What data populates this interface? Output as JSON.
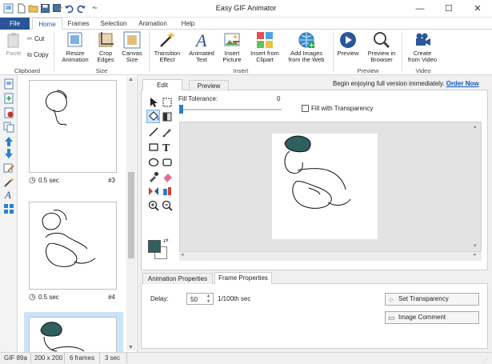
{
  "window": {
    "title": "Easy GIF Animator",
    "controls": [
      "minimize-icon",
      "maximize-icon",
      "close-icon"
    ]
  },
  "menu": {
    "file": "File",
    "tabs": [
      "Home",
      "Frames",
      "Selection",
      "Animation",
      "Help"
    ]
  },
  "ribbon": {
    "clipboard": {
      "paste": "Paste",
      "cut": "Cut",
      "copy": "Copy",
      "group": "Clipboard"
    },
    "size": {
      "resize": [
        "Resize",
        "Animation"
      ],
      "crop": [
        "Crop",
        "Edges"
      ],
      "canvas": [
        "Canvas",
        "Size"
      ],
      "group": "Size"
    },
    "insert": {
      "transition": [
        "Transition",
        "Effect"
      ],
      "text": [
        "Animated",
        "Text"
      ],
      "picture": [
        "Insert",
        "Picture"
      ],
      "clipart": [
        "Insert from",
        "Clipart"
      ],
      "web": [
        "Add Images",
        "from the Web"
      ],
      "group": "Insert"
    },
    "preview": {
      "preview": "Preview",
      "browser": [
        "Preview in",
        "Browser"
      ],
      "group": "Preview"
    },
    "video": {
      "create": [
        "Create",
        "from Video"
      ],
      "group": "Video"
    }
  },
  "frames": [
    {
      "delay": "0.5 sec",
      "number": "#3"
    },
    {
      "delay": "0.5 sec",
      "number": "#4"
    }
  ],
  "editor": {
    "tabs": [
      "Edit",
      "Preview"
    ],
    "promo": "Begin enjoying full version immediately.",
    "promo_link": "Order Now",
    "fill_tolerance_label": "Fill Tolerance:",
    "fill_tolerance_value": "0",
    "fill_transparency_label": "Fill with Transparency",
    "fill_transparency_checked": false
  },
  "colors": {
    "primary": "#2f5f5e",
    "secondary": "#ffffff",
    "accent": "#2a5699",
    "link": "#0b57c1"
  },
  "properties": {
    "tabs": [
      "Animation Properties",
      "Frame Properties"
    ],
    "delay_label": "Delay:",
    "delay_value": "50",
    "delay_unit": "1/100th sec",
    "set_transparency": "Set Transparency",
    "image_comment": "Image Comment"
  },
  "status": {
    "format": "GIF 89a",
    "size": "200 x 200",
    "frames": "6 frames",
    "duration": "3 sec"
  }
}
